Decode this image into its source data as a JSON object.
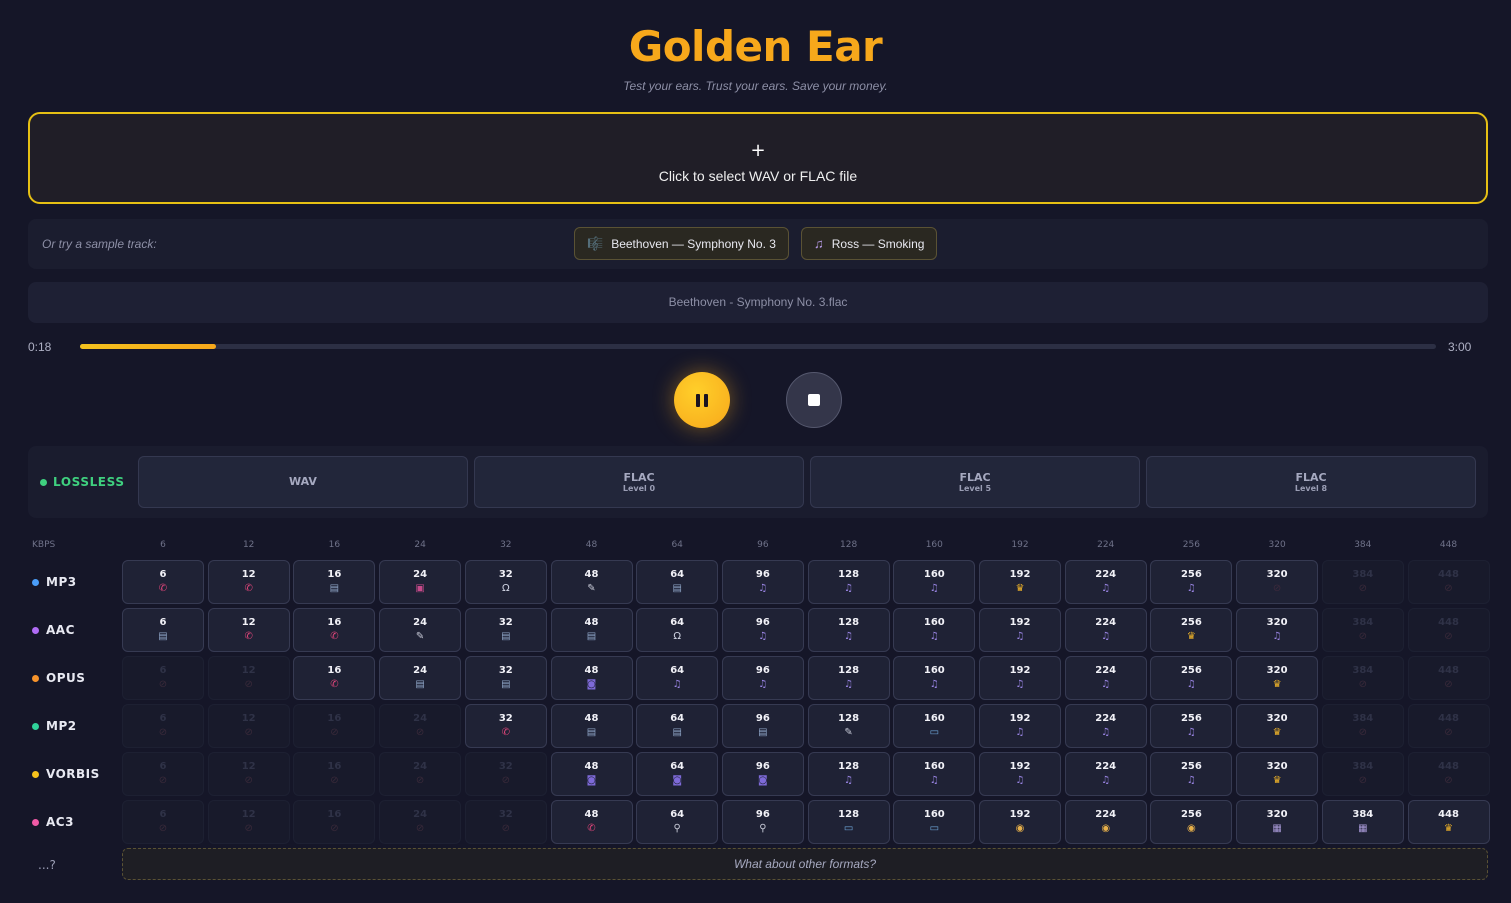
{
  "app": {
    "title": "Golden Ear",
    "subtitle": "Test your ears. Trust your ears. Save your money."
  },
  "dropzone": {
    "icon": "+",
    "label": "Click to select WAV or FLAC file"
  },
  "samples": {
    "label": "Or try a sample track:",
    "tracks": [
      {
        "icon": "portrait-icon",
        "glyph": "🎼",
        "label": "Beethoven — Symphony No. 3"
      },
      {
        "icon": "music-note-icon",
        "glyph": "♫",
        "label": "Ross — Smoking"
      }
    ]
  },
  "player": {
    "filename": "Beethoven - Symphony No. 3.flac",
    "elapsed": "0:18",
    "duration": "3:00",
    "progress": 0.1
  },
  "lossless": {
    "label": "LOSSLESS",
    "color": "#3fd07f",
    "formats": [
      {
        "name": "WAV",
        "level": ""
      },
      {
        "name": "FLAC",
        "level": "Level 0"
      },
      {
        "name": "FLAC",
        "level": "Level 5"
      },
      {
        "name": "FLAC",
        "level": "Level 8"
      }
    ]
  },
  "grid": {
    "unit_label": "KBPS",
    "bitrates": [
      "6",
      "12",
      "16",
      "24",
      "32",
      "48",
      "64",
      "96",
      "128",
      "160",
      "192",
      "224",
      "256",
      "320",
      "384",
      "448"
    ],
    "icon_legend": {
      "p": {
        "name": "phone-icon",
        "glyph": "✆",
        "color": "#e0457a"
      },
      "r": {
        "name": "radio-icon",
        "glyph": "▤",
        "color": "#8fa6c8"
      },
      "f": {
        "name": "floppy-icon",
        "glyph": "▣",
        "color": "#c64a8a"
      },
      "h": {
        "name": "headphones-icon",
        "glyph": "Ω",
        "color": "#cfd3e2"
      },
      "m": {
        "name": "microphone-icon",
        "glyph": "✎",
        "color": "#c8cbd8"
      },
      "n": {
        "name": "music-note-icon",
        "glyph": "♫",
        "color": "#9b86e6"
      },
      "t": {
        "name": "trophy-icon",
        "glyph": "♛",
        "color": "#f0b429"
      },
      "g": {
        "name": "gamepad-icon",
        "glyph": "◙",
        "color": "#7e6ad8"
      },
      "v": {
        "name": "tv-icon",
        "glyph": "▭",
        "color": "#6fa8dc"
      },
      "d": {
        "name": "disc-icon",
        "glyph": "◉",
        "color": "#e7b04a"
      },
      "c": {
        "name": "film-icon",
        "glyph": "▦",
        "color": "#a99ad8"
      },
      "s": {
        "name": "podcast-mic-icon",
        "glyph": "⚲",
        "color": "#c8cbd8"
      },
      "x": {
        "name": "unavailable-icon",
        "glyph": "⊘",
        "color": "#3d2a3c"
      }
    },
    "codecs": [
      {
        "name": "MP3",
        "color": "#4a9df8",
        "cells": [
          "p",
          "p",
          "r",
          "f",
          "h",
          "m",
          "r",
          "n",
          "n",
          "n",
          "t",
          "n",
          "n",
          "x",
          "x"
        ]
      },
      {
        "name": "AAC",
        "color": "#b06cf5",
        "cells": [
          "r",
          "p",
          "p",
          "m",
          "r",
          "r",
          "h",
          "n",
          "n",
          "n",
          "n",
          "n",
          "t",
          "n",
          "x",
          "x"
        ]
      },
      {
        "name": "OPUS",
        "color": "#f7932b",
        "cells": [
          "x",
          "x",
          "p",
          "r",
          "r",
          "g",
          "n",
          "n",
          "n",
          "n",
          "n",
          "n",
          "n",
          "t",
          "x",
          "x"
        ]
      },
      {
        "name": "MP2",
        "color": "#2fd29a",
        "cells": [
          "x",
          "x",
          "x",
          "x",
          "p",
          "r",
          "r",
          "r",
          "m",
          "v",
          "n",
          "n",
          "n",
          "t",
          "x",
          "x"
        ]
      },
      {
        "name": "VORBIS",
        "color": "#f6c21c",
        "cells": [
          "x",
          "x",
          "x",
          "x",
          "x",
          "g",
          "g",
          "g",
          "n",
          "n",
          "n",
          "n",
          "n",
          "t",
          "x",
          "x"
        ]
      },
      {
        "name": "AC3",
        "color": "#f05aa6",
        "cells": [
          "x",
          "x",
          "x",
          "x",
          "x",
          "p",
          "s",
          "s",
          "v",
          "v",
          "d",
          "d",
          "d",
          "c",
          "c",
          "t"
        ]
      }
    ],
    "enabled_from": [
      0,
      0,
      2,
      4,
      5,
      5
    ],
    "enabled_to": [
      13,
      13,
      13,
      13,
      13,
      15
    ]
  },
  "other": {
    "label": "...?",
    "button": "What about other formats?"
  }
}
